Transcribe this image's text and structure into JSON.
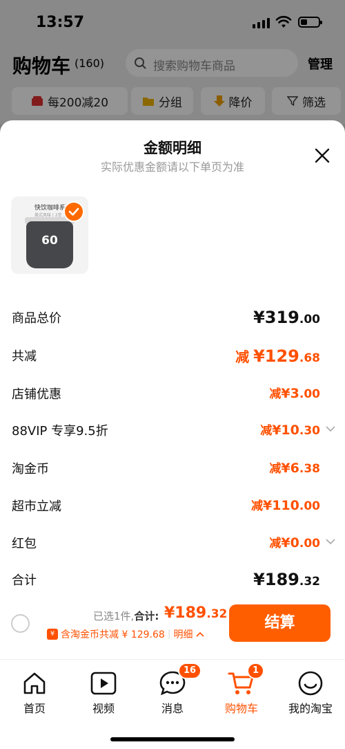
{
  "status_bar": {
    "time": "13:57"
  },
  "header": {
    "title": "购物车",
    "count": "(160)",
    "search_placeholder": "搜索购物车商品",
    "manage_label": "管理"
  },
  "filters": [
    {
      "label": "每200减20",
      "icon": "shop-coupon-icon"
    },
    {
      "label": "分组",
      "icon": "folder-icon"
    },
    {
      "label": "降价",
      "icon": "price-down-arrow-icon"
    },
    {
      "label": "筛选",
      "icon": "filter-icon"
    }
  ],
  "sheet": {
    "title": "金额明细",
    "subtitle": "实际优惠金额请以下单页为准",
    "product": {
      "name": "快饮咖啡系列",
      "sub": "美式风味 | 2至 1-60杯",
      "number": "60"
    },
    "rows": [
      {
        "label": "商品总价",
        "prefix": "",
        "amount": "¥319",
        "decimal": ".00"
      },
      {
        "label": "共减",
        "prefix": "减",
        "amount": "¥129",
        "decimal": ".68"
      },
      {
        "label": "店铺优惠",
        "prefix": "减",
        "amount": "¥3",
        "decimal": ".00"
      },
      {
        "label": "88VIP 专享9.5折",
        "prefix": "减",
        "amount": "¥10",
        "decimal": ".30"
      },
      {
        "label": "淘金币",
        "prefix": "减",
        "amount": "¥6",
        "decimal": ".38"
      },
      {
        "label": "超市立减",
        "prefix": "减",
        "amount": "¥110",
        "decimal": ".00"
      },
      {
        "label": "红包",
        "prefix": "减",
        "amount": "¥0",
        "decimal": ".00"
      },
      {
        "label": "合计",
        "prefix": "",
        "amount": "¥189",
        "decimal": ".32"
      }
    ]
  },
  "checkout": {
    "selected_text": "已选1件,",
    "total_label": "合计:",
    "total_amount": "¥189",
    "total_decimal": ".32",
    "discount_text": "含淘金币共减 ¥ 129.68",
    "detail_label": "明细",
    "pay_label": "结算"
  },
  "tabbar": [
    {
      "label": "首页",
      "icon": "home-icon",
      "badge": ""
    },
    {
      "label": "视频",
      "icon": "video-play-icon",
      "badge": ""
    },
    {
      "label": "消息",
      "icon": "chat-bubble-icon",
      "badge": "16"
    },
    {
      "label": "购物车",
      "icon": "cart-icon",
      "badge": "1"
    },
    {
      "label": "我的淘宝",
      "icon": "smile-face-icon",
      "badge": ""
    }
  ],
  "colors": {
    "accent": "#ff5000",
    "button": "#ff5e00"
  }
}
